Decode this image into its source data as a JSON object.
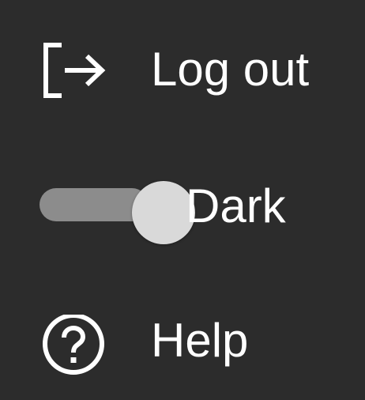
{
  "menu": {
    "items": [
      {
        "label": "Log out",
        "icon": "logout-icon"
      },
      {
        "label": "Dark",
        "icon": "toggle-switch",
        "checked": true
      },
      {
        "label": "Help",
        "icon": "help-circle-icon"
      }
    ]
  },
  "colors": {
    "background": "#2c2c2c",
    "text": "#ffffff",
    "toggle_track": "#8c8c8c",
    "toggle_thumb": "#d9d9d9"
  }
}
